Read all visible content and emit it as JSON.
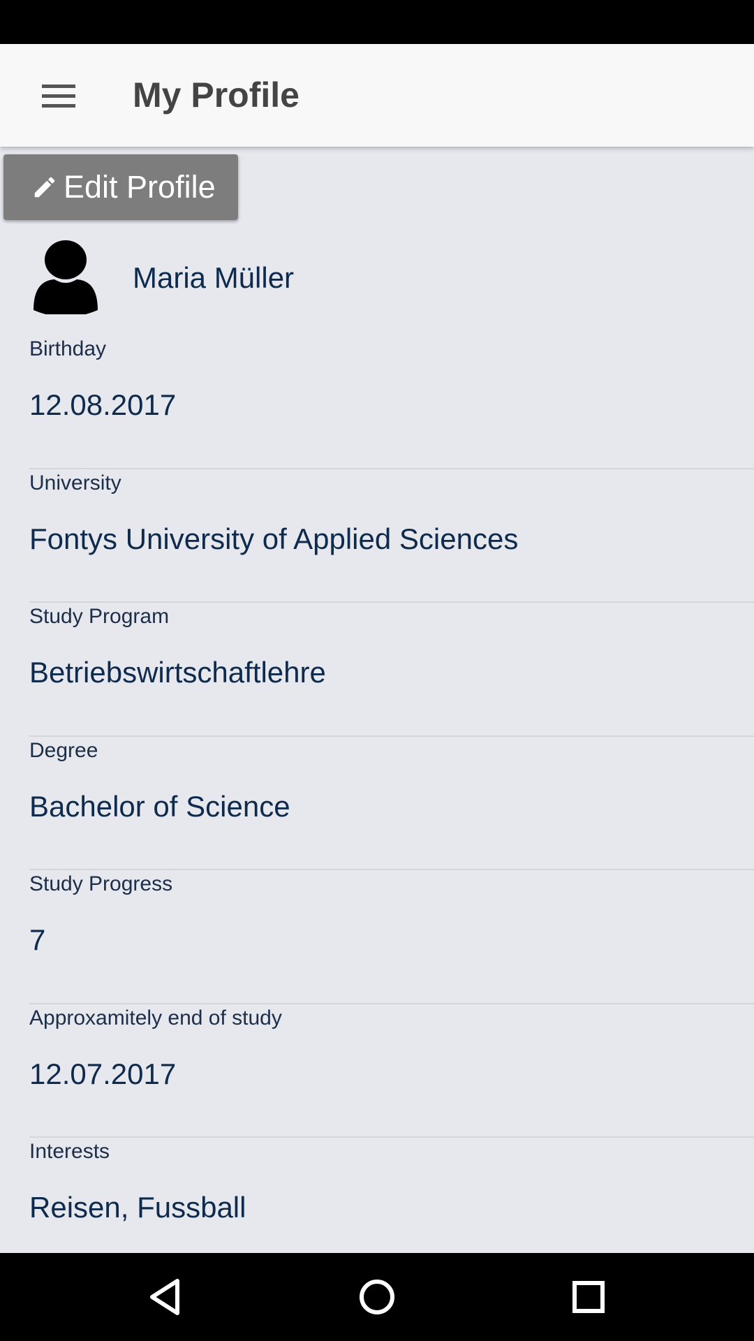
{
  "header": {
    "title": "My Profile"
  },
  "toolbar": {
    "edit_label": "Edit Profile"
  },
  "profile": {
    "name": "Maria Müller"
  },
  "fields": [
    {
      "label": "Birthday",
      "value": "12.08.2017"
    },
    {
      "label": "University",
      "value": "Fontys University of Applied Sciences"
    },
    {
      "label": "Study Program",
      "value": "Betriebswirtschaftlehre"
    },
    {
      "label": "Degree",
      "value": "Bachelor of Science"
    },
    {
      "label": "Study Progress",
      "value": "7"
    },
    {
      "label": "Approxamitely end of study",
      "value": "12.07.2017"
    },
    {
      "label": "Interests",
      "value": "Reisen, Fussball"
    }
  ],
  "icons": {
    "menu": "menu-icon",
    "edit": "pencil-icon",
    "avatar": "person-silhouette-icon",
    "nav_back": "back-triangle-icon",
    "nav_home": "home-circle-icon",
    "nav_recents": "recents-square-icon"
  },
  "colors": {
    "app_bar": "#f8f8f8",
    "background": "#e6e8ee",
    "button": "#7d7d7d",
    "text_primary": "#0e2a4c",
    "title": "#444444"
  }
}
